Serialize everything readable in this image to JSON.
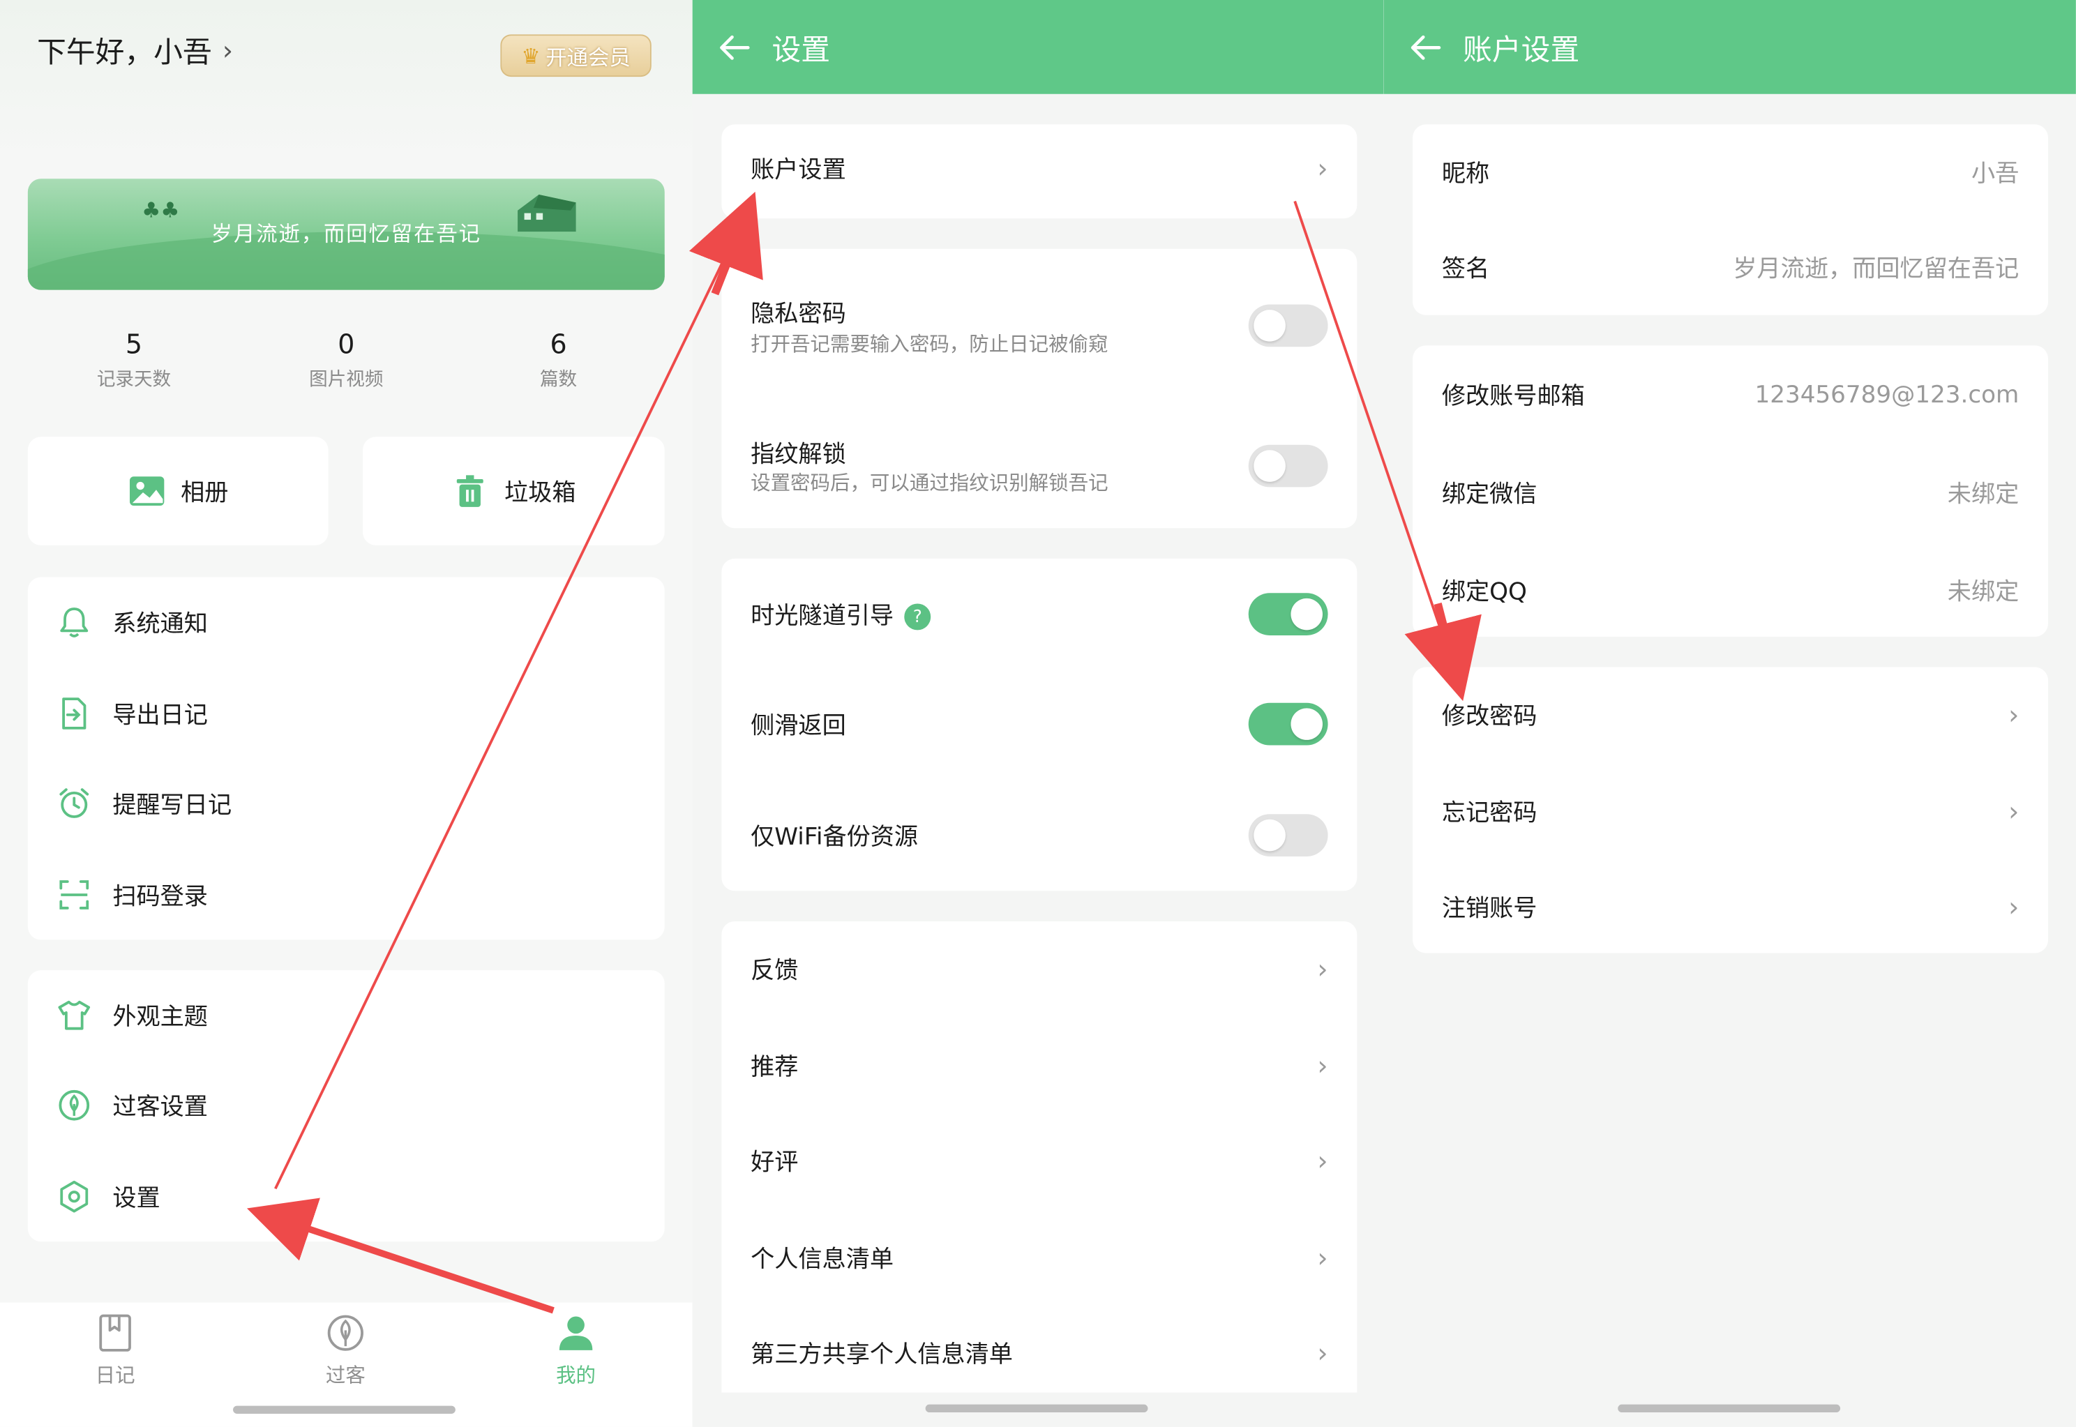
{
  "home": {
    "greeting": "下午好，小吾",
    "vip_label": "开通会员",
    "banner_text": "岁月流逝，而回忆留在吾记",
    "stats": [
      {
        "value": "5",
        "label": "记录天数"
      },
      {
        "value": "0",
        "label": "图片视频"
      },
      {
        "value": "6",
        "label": "篇数"
      }
    ],
    "quick": {
      "album": "相册",
      "trash": "垃圾箱"
    },
    "menu1": [
      "系统通知",
      "导出日记",
      "提醒写日记",
      "扫码登录"
    ],
    "menu2": [
      "外观主题",
      "过客设置",
      "设置"
    ],
    "tabs": [
      "日记",
      "过客",
      "我的"
    ]
  },
  "settings": {
    "title": "设置",
    "account": "账户设置",
    "privacy": {
      "label": "隐私密码",
      "desc": "打开吾记需要输入密码，防止日记被偷窥"
    },
    "fingerprint": {
      "label": "指纹解锁",
      "desc": "设置密码后，可以通过指纹识别解锁吾记"
    },
    "tunnel": "时光隧道引导",
    "help_mark": "?",
    "swipe_back": "侧滑返回",
    "wifi_backup": "仅WiFi备份资源",
    "links": [
      "反馈",
      "推荐",
      "好评",
      "个人信息清单",
      "第三方共享个人信息清单"
    ]
  },
  "account": {
    "title": "账户设置",
    "nickname": {
      "label": "昵称",
      "value": "小吾"
    },
    "signature": {
      "label": "签名",
      "value": "岁月流逝，而回忆留在吾记"
    },
    "email": {
      "label": "修改账号邮箱",
      "value": "123456789@123.com"
    },
    "wechat": {
      "label": "绑定微信",
      "value": "未绑定"
    },
    "qq": {
      "label": "绑定QQ",
      "value": "未绑定"
    },
    "actions": [
      "修改密码",
      "忘记密码",
      "注销账号"
    ]
  },
  "colors": {
    "accent": "#5fc888",
    "annotation_arrow": "#ee4a4a"
  }
}
